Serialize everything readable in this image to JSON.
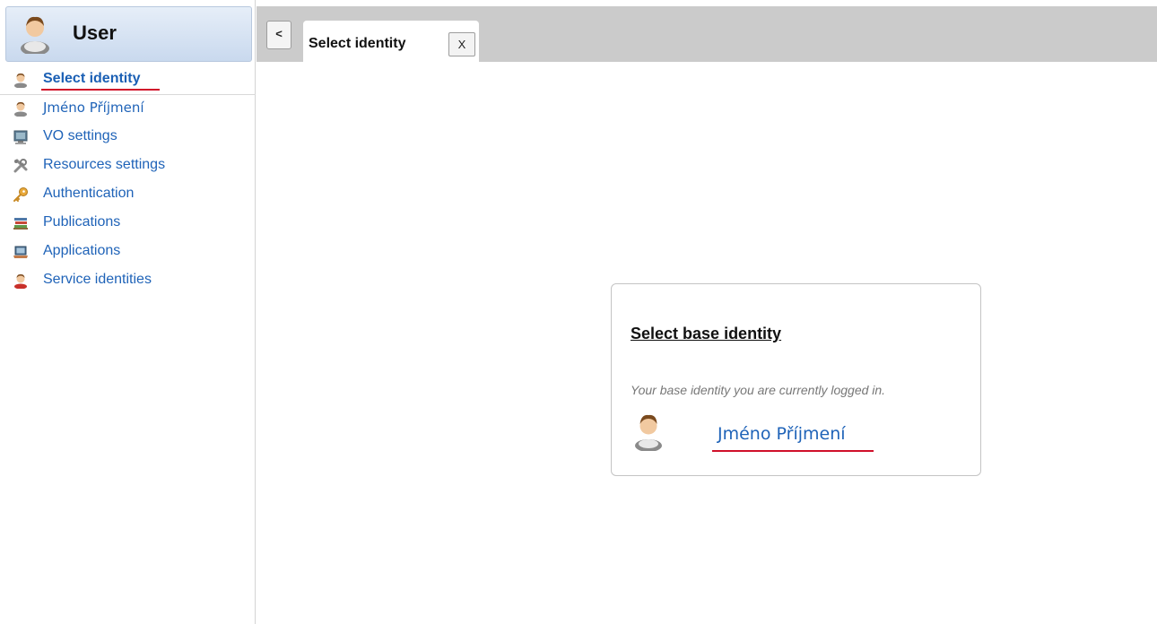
{
  "sidebar": {
    "title": "User",
    "items": [
      {
        "label": "Select identity",
        "icon": "user-icon",
        "active": true
      },
      {
        "label": "Jméno Příjmení",
        "icon": "user-icon"
      },
      {
        "label": "VO settings",
        "icon": "computer-icon"
      },
      {
        "label": "Resources settings",
        "icon": "tools-icon"
      },
      {
        "label": "Authentication",
        "icon": "key-icon"
      },
      {
        "label": "Publications",
        "icon": "books-icon"
      },
      {
        "label": "Applications",
        "icon": "laptop-icon"
      },
      {
        "label": "Service identities",
        "icon": "service-user-icon"
      }
    ]
  },
  "tabbar": {
    "collapse_label": "<",
    "tab_label": "Select identity",
    "close_label": "X"
  },
  "card": {
    "title": "Select base identity",
    "description": "Your base identity you are currently logged in.",
    "identity_name": "Jméno Příjmení"
  },
  "colors": {
    "link": "#1f63b8",
    "active_underline": "#d0102a",
    "tabbar_bg": "#cbcbcb",
    "header_gradient_top": "#e6eef8",
    "header_gradient_bottom": "#c9d9ee"
  }
}
